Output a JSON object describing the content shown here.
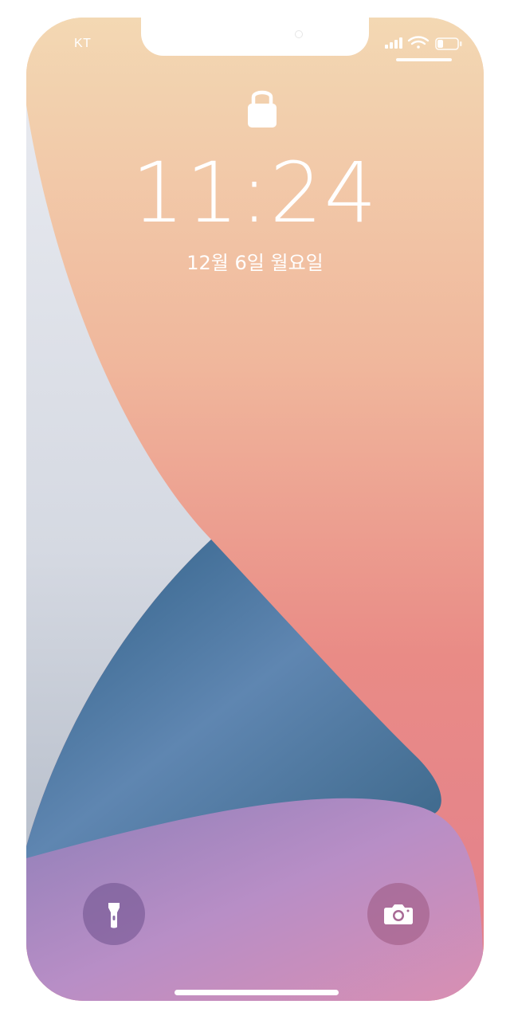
{
  "status_bar": {
    "carrier": "KT",
    "icons": [
      "cellular-signal-icon",
      "wifi-icon",
      "battery-icon"
    ],
    "battery_level": 0.25
  },
  "lock_screen": {
    "lock_icon": "lock-icon",
    "time": "11:24",
    "date": "12월 6일 월요일"
  },
  "quick_actions": {
    "left_icon": "flashlight-icon",
    "right_icon": "camera-icon"
  },
  "colors": {
    "peach": "#f1c9a4",
    "coral": "#e8848a",
    "blue": "#3f6f95",
    "lavender": "#b08ec4",
    "silver": "#d8dde5"
  }
}
